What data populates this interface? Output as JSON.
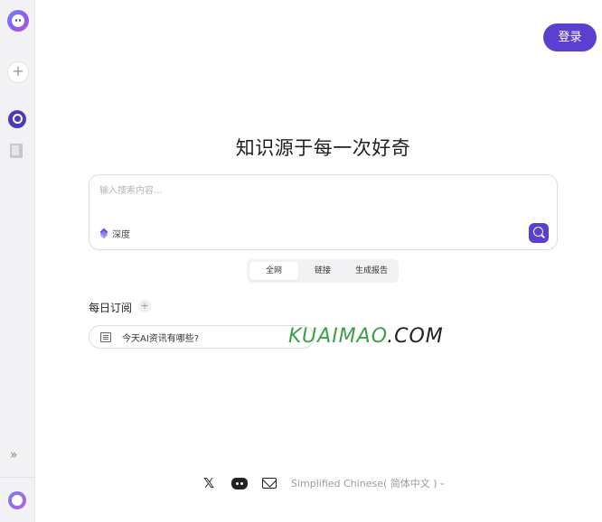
{
  "sidebar": {
    "logo": "ai-mascot-logo",
    "new_chat_label": "+",
    "nav": [
      {
        "icon": "search-icon",
        "active": true
      },
      {
        "icon": "book-icon",
        "active": false
      }
    ],
    "expand_label": "»"
  },
  "header": {
    "login_label": "登录"
  },
  "main": {
    "headline": "知识源于每一次好奇",
    "search": {
      "placeholder": "输入搜索内容...",
      "depth_label": "深度"
    },
    "tabs": [
      {
        "label": "全网",
        "active": true
      },
      {
        "label": "链接",
        "active": false
      },
      {
        "label": "生成报告",
        "active": false
      }
    ],
    "daily": {
      "title": "每日订阅",
      "add_label": "+",
      "suggestion": "今天AI资讯有哪些?"
    }
  },
  "watermark": {
    "part1": "KUAIMAO",
    "part2": ".COM"
  },
  "footer": {
    "x_label": "𝕏",
    "language": "Simplified Chinese( 简体中文 )",
    "language_chevron": "⌄"
  },
  "colors": {
    "accent": "#5b3fd1",
    "sidebar_bg": "#f2f2f4",
    "watermark_green": "#3aa14a"
  }
}
